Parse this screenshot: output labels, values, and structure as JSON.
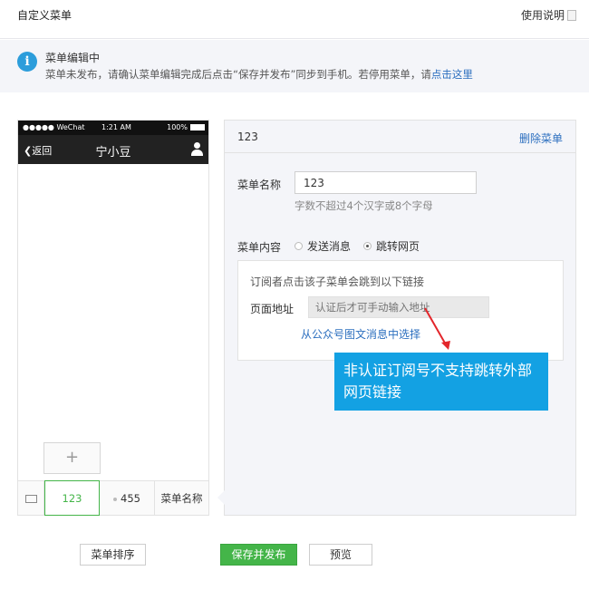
{
  "header": {
    "title": "自定义菜单",
    "help_label": "使用说明"
  },
  "notice": {
    "title": "菜单编辑中",
    "text_prefix": "菜单未发布，请确认菜单编辑完成后点击“保存并发布”同步到手机。若停用菜单，请",
    "link_label": "点击这里"
  },
  "phone": {
    "carrier": "●●●●● WeChat",
    "time": "1:21 AM",
    "battery": "100%",
    "back_label": "返回",
    "account_name": "宁小豆",
    "add_submenu_label": "+",
    "menu_items": [
      "123",
      "455",
      "菜单名称"
    ]
  },
  "editor": {
    "menu_name": "123",
    "delete_label": "删除菜单",
    "name_label": "菜单名称",
    "name_value": "123",
    "name_hint": "字数不超过4个汉字或8个字母",
    "content_label": "菜单内容",
    "options": [
      "发送消息",
      "跳转网页"
    ],
    "selected_option": "跳转网页",
    "redirect_desc": "订阅者点击该子菜单会跳到以下链接",
    "url_label": "页面地址",
    "url_placeholder": "认证后才可手动输入地址",
    "pick_link_label": "从公众号图文消息中选择"
  },
  "callout": {
    "text": "非认证订阅号不支持跳转外部网页链接"
  },
  "footer": {
    "sort_label": "菜单排序",
    "save_label": "保存并发布",
    "preview_label": "预览"
  },
  "colors": {
    "accent_green": "#44b549",
    "link_blue": "#2c6fbf",
    "callout_blue": "#13a1e3",
    "info_blue": "#2c9ddb"
  }
}
